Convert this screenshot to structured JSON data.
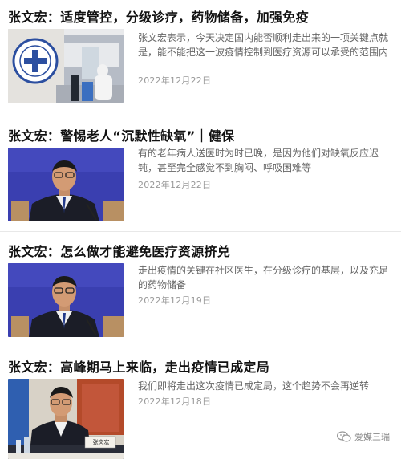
{
  "articles": [
    {
      "title": "张文宏：适度管控，分级诊疗，药物储备，加强免疫",
      "summary": "张文宏表示，今天决定国内能否顺利走出来的一项关键点就是，能不能把这一波疫情控制到医疗资源可以承受的范围内",
      "date": "2022年12月22日",
      "thumb_icon": "hospital-scene-image"
    },
    {
      "title": "张文宏：警惕老人“沉默性缺氧”｜健保",
      "summary": "有的老年病人送医时为时已晚，是因为他们对缺氧反应迟钝，甚至完全感觉不到胸闷、呼吸困难等",
      "date": "2022年12月22日",
      "thumb_icon": "press-conference-image"
    },
    {
      "title": "张文宏：怎么做才能避免医疗资源挤兑",
      "summary": "走出疫情的关键在社区医生，在分级诊疗的基层，以及充足的药物储备",
      "date": "2022年12月19日",
      "thumb_icon": "press-conference-image"
    },
    {
      "title": "张文宏：高峰期马上来临，走出疫情已成定局",
      "summary": "我们即将走出这次疫情已成定局，这个趋势不会再逆转",
      "date": "2022年12月18日",
      "thumb_icon": "speaker-at-desk-image",
      "nameplate": "张文宏"
    }
  ],
  "watermark": {
    "label": "爱媒三瑞",
    "icon": "wechat-icon"
  },
  "colors": {
    "title": "#111111",
    "summary": "#666666",
    "date": "#999999",
    "divider": "#e8e8e8",
    "press_blue": "#3a3fb0"
  }
}
